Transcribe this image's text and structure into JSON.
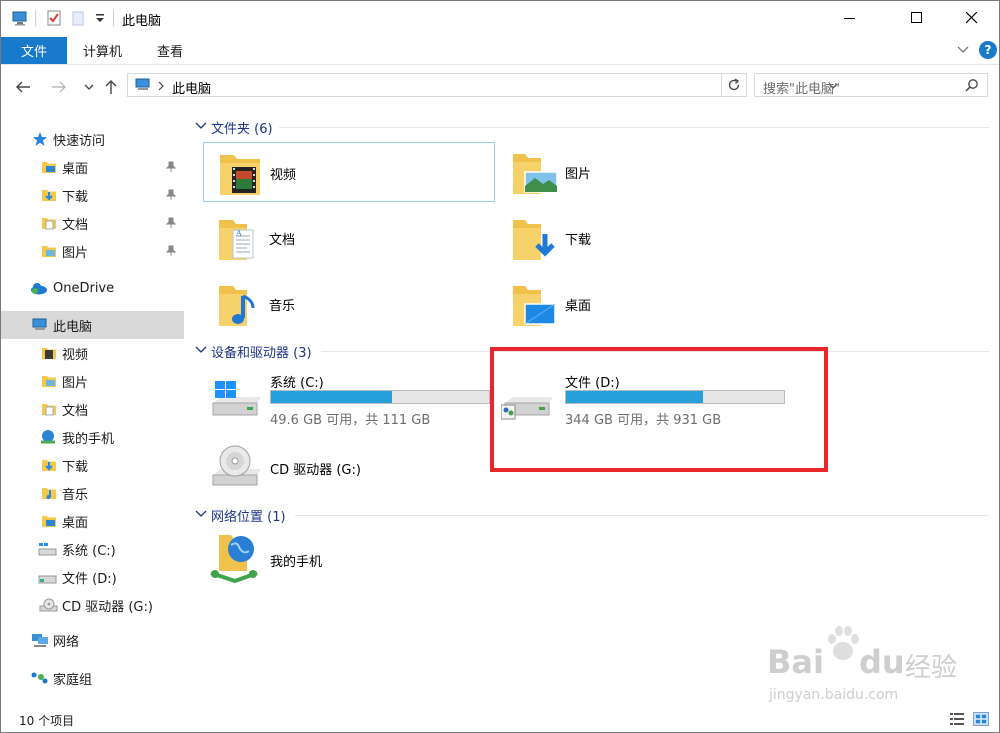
{
  "window": {
    "title": "此电脑",
    "controls": {
      "minimize": "—",
      "maximize": "☐",
      "close": "✕"
    }
  },
  "ribbon": {
    "tabs": [
      {
        "label": "文件",
        "active": true
      },
      {
        "label": "计算机"
      },
      {
        "label": "查看"
      }
    ],
    "help": "?"
  },
  "address": {
    "path": "此电脑",
    "separator": ">"
  },
  "search": {
    "placeholder": "搜索\"此电脑\""
  },
  "nav_pane": {
    "quick_access": {
      "label": "快速访问",
      "items": [
        {
          "label": "桌面",
          "icon": "desktop-folder-icon",
          "pinned": true
        },
        {
          "label": "下载",
          "icon": "downloads-folder-icon",
          "pinned": true
        },
        {
          "label": "文档",
          "icon": "documents-folder-icon",
          "pinned": true
        },
        {
          "label": "图片",
          "icon": "pictures-folder-icon",
          "pinned": true
        }
      ]
    },
    "onedrive": {
      "label": "OneDrive"
    },
    "this_pc": {
      "label": "此电脑",
      "items": [
        {
          "label": "视频",
          "icon": "videos-folder-icon"
        },
        {
          "label": "图片",
          "icon": "pictures-folder-icon"
        },
        {
          "label": "文档",
          "icon": "documents-folder-icon"
        },
        {
          "label": "我的手机",
          "icon": "phone-icon"
        },
        {
          "label": "下载",
          "icon": "downloads-folder-icon"
        },
        {
          "label": "音乐",
          "icon": "music-folder-icon"
        },
        {
          "label": "桌面",
          "icon": "desktop-folder-icon"
        },
        {
          "label": "系统 (C:)",
          "icon": "windows-drive-icon"
        },
        {
          "label": "文件 (D:)",
          "icon": "drive-icon"
        },
        {
          "label": "CD 驱动器 (G:)",
          "icon": "cd-drive-icon"
        }
      ]
    },
    "network": {
      "label": "网络"
    },
    "homegroup": {
      "label": "家庭组"
    }
  },
  "content": {
    "folders_group": {
      "title": "文件夹 (6)",
      "items": [
        {
          "label": "视频",
          "icon": "videos-folder-icon"
        },
        {
          "label": "图片",
          "icon": "pictures-folder-icon"
        },
        {
          "label": "文档",
          "icon": "documents-folder-icon"
        },
        {
          "label": "下载",
          "icon": "downloads-folder-icon"
        },
        {
          "label": "音乐",
          "icon": "music-folder-icon"
        },
        {
          "label": "桌面",
          "icon": "desktop-folder-icon"
        }
      ]
    },
    "devices_group": {
      "title": "设备和驱动器 (3)",
      "drives": [
        {
          "name": "系统 (C:)",
          "free_text": "49.6 GB 可用，共 111 GB",
          "used_fraction": 0.553
        },
        {
          "name": "文件 (D:)",
          "free_text": "344 GB 可用，共 931 GB",
          "used_fraction": 0.63
        }
      ],
      "cd": {
        "name": "CD 驱动器 (G:)"
      }
    },
    "network_group": {
      "title": "网络位置 (1)",
      "items": [
        {
          "label": "我的手机",
          "icon": "network-phone-icon"
        }
      ]
    }
  },
  "status_bar": {
    "item_count": "10 个项目"
  },
  "watermark": {
    "brand": "Bai",
    "brand2": "du",
    "brand3": "经验",
    "url": "jingyan.baidu.com"
  },
  "colors": {
    "accent": "#1979ca",
    "bar_fill": "#26a0da",
    "highlight_box": "#e8262b",
    "group_header": "#1e3287"
  }
}
